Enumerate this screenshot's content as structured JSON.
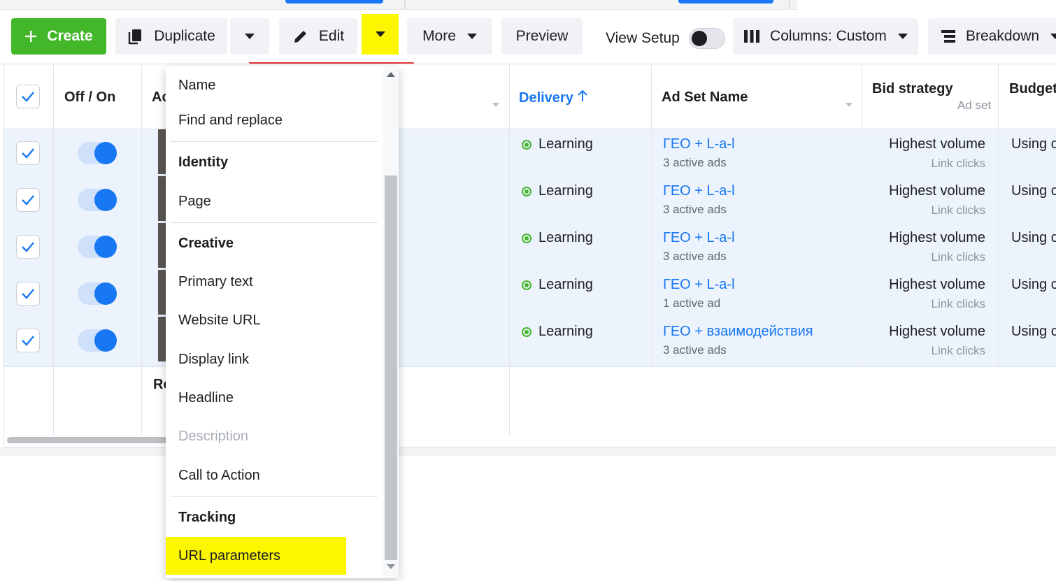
{
  "toolbar": {
    "create_label": "Create",
    "duplicate_label": "Duplicate",
    "edit_label": "Edit",
    "more_label": "More",
    "preview_label": "Preview",
    "view_setup_label": "View Setup",
    "columns_label": "Columns: Custom",
    "breakdown_label": "Breakdown"
  },
  "table": {
    "headers": {
      "off_on": "Off / On",
      "ad_partial": "Ac",
      "delivery": "Delivery",
      "ad_set_name": "Ad Set Name",
      "bid_strategy": "Bid strategy",
      "bid_strategy_sub": "Ad set",
      "budget": "Budget"
    },
    "rows": [
      {
        "delivery": "Learning",
        "ad_set": "ГЕО + L-a-l",
        "ads": "3 active ads",
        "bid": "Highest volume",
        "bid_sub": "Link clicks",
        "budget": "Using c"
      },
      {
        "delivery": "Learning",
        "ad_set": "ГЕО + L-a-l",
        "ads": "3 active ads",
        "bid": "Highest volume",
        "bid_sub": "Link clicks",
        "budget": "Using c"
      },
      {
        "delivery": "Learning",
        "ad_set": "ГЕО + L-a-l",
        "ads": "3 active ads",
        "bid": "Highest volume",
        "bid_sub": "Link clicks",
        "budget": "Using c"
      },
      {
        "delivery": "Learning",
        "ad_set": "ГЕО + L-a-l",
        "ads": "1 active ad",
        "bid": "Highest volume",
        "bid_sub": "Link clicks",
        "budget": "Using c"
      },
      {
        "delivery": "Learning",
        "ad_set": "ГЕО + взаимодействия",
        "ads": "3 active ads",
        "bid": "Highest volume",
        "bid_sub": "Link clicks",
        "budget": "Using c"
      }
    ],
    "footer_partial": "Re"
  },
  "edit_menu": {
    "items": [
      {
        "label": "Name",
        "kind": "item"
      },
      {
        "label": "Find and replace",
        "kind": "item"
      },
      {
        "label": "Identity",
        "kind": "header"
      },
      {
        "label": "Page",
        "kind": "item"
      },
      {
        "label": "Creative",
        "kind": "header"
      },
      {
        "label": "Primary text",
        "kind": "item"
      },
      {
        "label": "Website URL",
        "kind": "item"
      },
      {
        "label": "Display link",
        "kind": "item"
      },
      {
        "label": "Headline",
        "kind": "item"
      },
      {
        "label": "Description",
        "kind": "disabled"
      },
      {
        "label": "Call to Action",
        "kind": "item"
      },
      {
        "label": "Tracking",
        "kind": "header"
      },
      {
        "label": "URL parameters",
        "kind": "highlighted"
      }
    ]
  },
  "colors": {
    "accent": "#1877f2",
    "create_green": "#42b72a",
    "highlight_yellow": "#fcf600",
    "selected_row": "#ecf3fd"
  }
}
